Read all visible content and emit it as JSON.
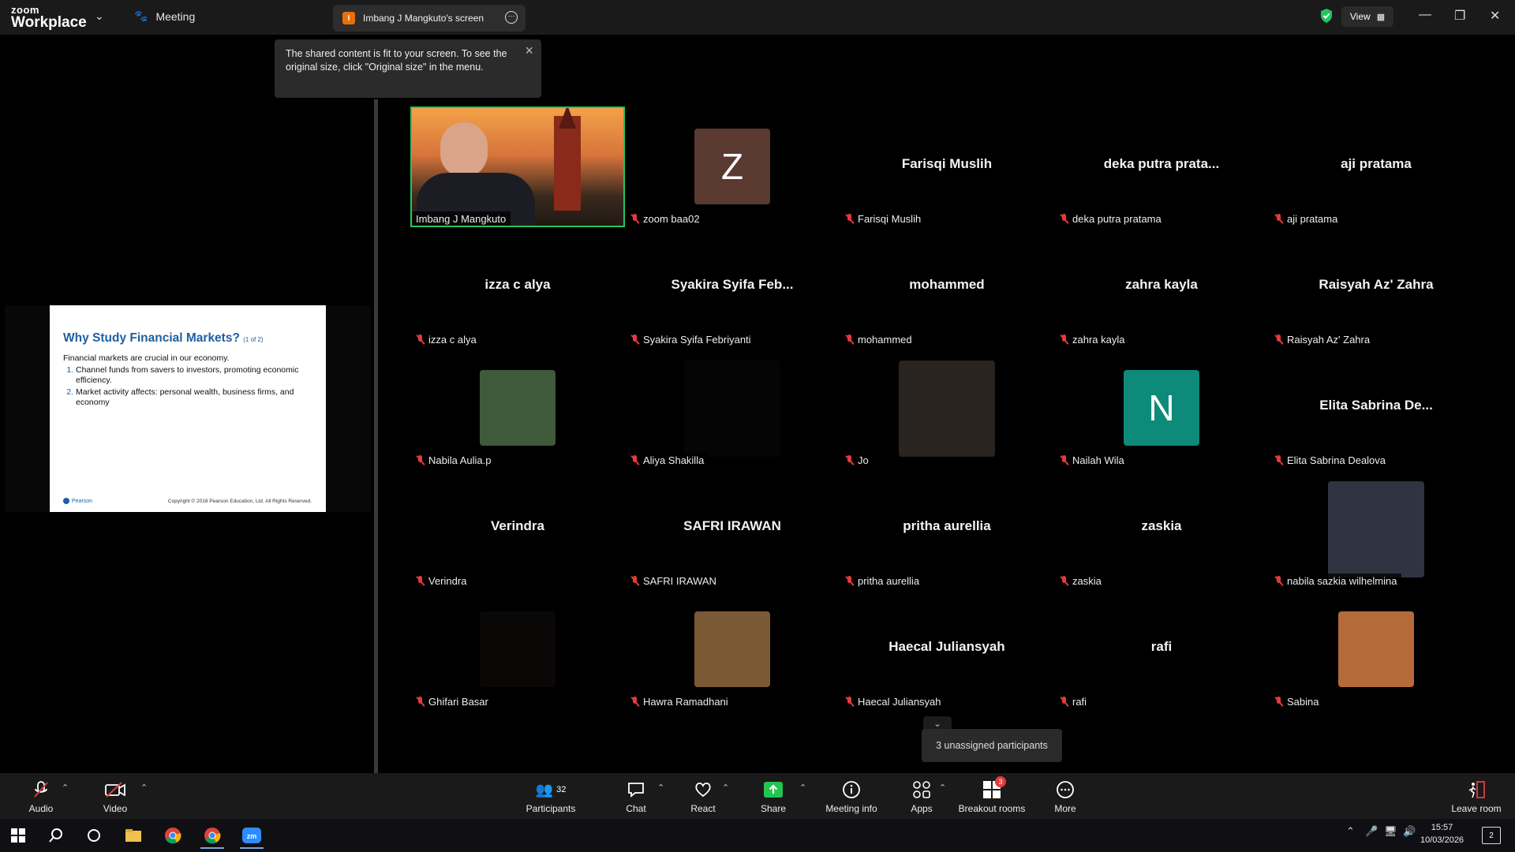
{
  "app": {
    "logo_top": "zoom",
    "logo_bottom": "Workplace",
    "meeting_label": "Meeting",
    "view_label": "View"
  },
  "share_tab": {
    "badge": "I",
    "title": "Imbang J Mangkuto's screen"
  },
  "tooltip": {
    "text": "The shared content is fit to your screen. To see the original size, click \"Original size\" in the menu."
  },
  "slide": {
    "title": "Why Study Financial Markets?",
    "title_note": "(1 of 2)",
    "intro": "Financial markets are crucial in our economy.",
    "points": [
      "Channel funds from savers to investors, promoting economic efficiency.",
      "Market activity affects: personal wealth, business firms, and economy"
    ],
    "brand": "Pearson",
    "copyright": "Copyright © 2018 Pearson Education, Ltd. All Rights Reserved."
  },
  "participants": [
    {
      "label": "Imbang J Mangkuto",
      "center": "",
      "type": "video"
    },
    {
      "label": "zoom baa02",
      "center": "Z",
      "type": "letter",
      "color": "#5a3a30"
    },
    {
      "label": "Farisqi Muslih",
      "center": "Farisqi Muslih",
      "type": "name"
    },
    {
      "label": "deka putra pratama",
      "center": "deka putra prata...",
      "type": "name"
    },
    {
      "label": "aji pratama",
      "center": "aji pratama",
      "type": "name"
    },
    {
      "label": "izza c alya",
      "center": "izza c alya",
      "type": "name"
    },
    {
      "label": "Syakira Syifa Febriyanti",
      "center": "Syakira Syifa Feb...",
      "type": "name"
    },
    {
      "label": "mohammed",
      "center": "mohammed",
      "type": "name"
    },
    {
      "label": "zahra kayla",
      "center": "zahra kayla",
      "type": "name"
    },
    {
      "label": "Raisyah Az' Zahra",
      "center": "Raisyah Az' Zahra",
      "type": "name"
    },
    {
      "label": "Nabila Aulia.p",
      "center": "",
      "type": "photo",
      "color": "#3f5a3a"
    },
    {
      "label": "Aliya Shakilla",
      "center": "",
      "type": "photo",
      "color": "#050505"
    },
    {
      "label": "Jo",
      "center": "",
      "type": "photo",
      "color": "#2a2420"
    },
    {
      "label": "Nailah Wila",
      "center": "N",
      "type": "letter",
      "color": "#0d8a7a"
    },
    {
      "label": "Elita Sabrina Dealova",
      "center": "Elita Sabrina De...",
      "type": "name"
    },
    {
      "label": "Verindra",
      "center": "Verindra",
      "type": "name"
    },
    {
      "label": "SAFRI IRAWAN",
      "center": "SAFRI IRAWAN",
      "type": "name"
    },
    {
      "label": "pritha aurellia",
      "center": "pritha aurellia",
      "type": "name"
    },
    {
      "label": "zaskia",
      "center": "zaskia",
      "type": "name"
    },
    {
      "label": "nabila sazkia wilhelmina",
      "center": "",
      "type": "photo",
      "color": "#2e3442"
    },
    {
      "label": "Ghifari Basar",
      "center": "",
      "type": "photo",
      "color": "#0a0707"
    },
    {
      "label": "Hawra Ramadhani",
      "center": "",
      "type": "photo",
      "color": "#7a5a34"
    },
    {
      "label": "Haecal Juliansyah",
      "center": "Haecal Juliansyah",
      "type": "name"
    },
    {
      "label": "rafi",
      "center": "rafi",
      "type": "name"
    },
    {
      "label": "Sabina",
      "center": "",
      "type": "photo",
      "color": "#b56a3a"
    }
  ],
  "toolbar": {
    "audio": "Audio",
    "video": "Video",
    "participants": "Participants",
    "participants_count": "32",
    "chat": "Chat",
    "react": "React",
    "share": "Share",
    "meeting_info": "Meeting info",
    "apps": "Apps",
    "breakout": "Breakout rooms",
    "breakout_badge": "3",
    "more": "More",
    "leave": "Leave room"
  },
  "unassigned": "3 unassigned participants",
  "taskbar": {
    "time": "15:57",
    "date": "10/03/2026",
    "notifications": "2"
  },
  "colors": {
    "accent_green": "#22c55e",
    "muted_red": "#e23b3b",
    "share_green": "#23c552"
  }
}
